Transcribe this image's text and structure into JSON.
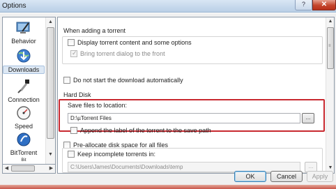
{
  "window": {
    "title": "Options",
    "help_label": "?",
    "close_label": "✕"
  },
  "categories": [
    {
      "label": "Behavior",
      "icon": "behavior-icon"
    },
    {
      "label": "Downloads",
      "icon": "downloads-globe-icon"
    },
    {
      "label": "Connection",
      "icon": "connection-plug-icon"
    },
    {
      "label": "Speed",
      "icon": "speed-gauge-icon"
    },
    {
      "label": "BitTorrent",
      "icon": "bittorrent-icon"
    },
    {
      "label": "Bit"
    }
  ],
  "selected_category": "Downloads",
  "panel": {
    "adding_group": "When adding a torrent",
    "display_content": "Display torrent content and some options",
    "bring_front": "Bring torrent dialog to the front",
    "no_autostart": "Do not start the download automatically",
    "hard_disk_group": "Hard Disk",
    "save_to_label": "Save files to location:",
    "save_path": "D:\\µTorrent Files",
    "append_label": "Append the label of the torrent to the save path",
    "preallocate": "Pre-allocate disk space for all files",
    "keep_incomplete": "Keep incomplete torrents in:",
    "incomplete_path": "C:\\Users\\James\\Documents\\Downloads\\temp",
    "browse_label": "..."
  },
  "buttons": {
    "ok": "OK",
    "cancel": "Cancel",
    "apply": "Apply"
  },
  "colors": {
    "highlight": "#c8282f",
    "close_button": "#c4452b"
  }
}
